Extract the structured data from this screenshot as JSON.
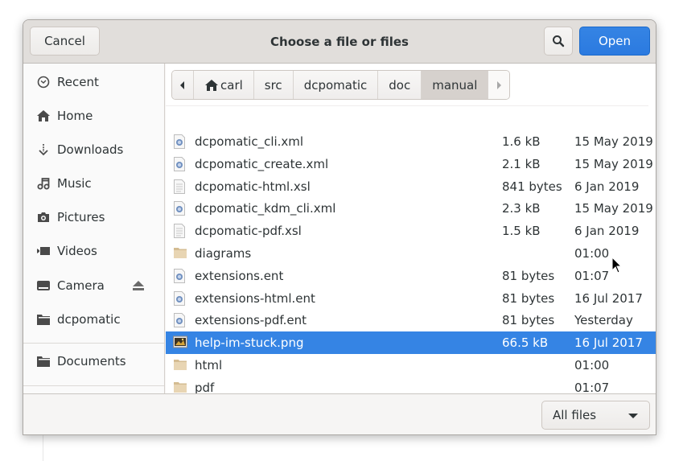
{
  "dialog": {
    "title": "Choose a file or files",
    "cancel_label": "Cancel",
    "open_label": "Open",
    "search_icon": "search-icon",
    "accent_color": "#3584e4"
  },
  "sidebar": {
    "items": [
      {
        "label": "Recent",
        "icon": "clock-icon"
      },
      {
        "label": "Home",
        "icon": "home-icon"
      },
      {
        "label": "Downloads",
        "icon": "download-icon"
      },
      {
        "label": "Music",
        "icon": "music-icon"
      },
      {
        "label": "Pictures",
        "icon": "camera-icon"
      },
      {
        "label": "Videos",
        "icon": "video-icon"
      },
      {
        "label": "Camera",
        "icon": "drive-icon",
        "eject": true
      },
      {
        "label": "dcpomatic",
        "icon": "folder-icon"
      },
      {
        "label": "Documents",
        "icon": "folder-icon"
      }
    ]
  },
  "pathbar": {
    "segments": [
      "carl",
      "src",
      "dcpomatic",
      "doc",
      "manual"
    ],
    "active": "manual"
  },
  "files": [
    {
      "name": "dcpomatic_cli.xml",
      "size": "1.6 kB",
      "modified": "15 May 2019",
      "type": "xml"
    },
    {
      "name": "dcpomatic_create.xml",
      "size": "2.1 kB",
      "modified": "15 May 2019",
      "type": "xml"
    },
    {
      "name": "dcpomatic-html.xsl",
      "size": "841 bytes",
      "modified": "6 Jan 2019",
      "type": "text"
    },
    {
      "name": "dcpomatic_kdm_cli.xml",
      "size": "2.3 kB",
      "modified": "15 May 2019",
      "type": "xml"
    },
    {
      "name": "dcpomatic-pdf.xsl",
      "size": "1.5 kB",
      "modified": "6 Jan 2019",
      "type": "text"
    },
    {
      "name": "diagrams",
      "size": "",
      "modified": "01:00",
      "type": "folder"
    },
    {
      "name": "extensions.ent",
      "size": "81 bytes",
      "modified": "01:07",
      "type": "xml"
    },
    {
      "name": "extensions-html.ent",
      "size": "81 bytes",
      "modified": "16 Jul 2017",
      "type": "xml"
    },
    {
      "name": "extensions-pdf.ent",
      "size": "81 bytes",
      "modified": "Yesterday",
      "type": "xml"
    },
    {
      "name": "help-im-stuck.png",
      "size": "66.5 kB",
      "modified": "16 Jul 2017",
      "type": "image",
      "selected": true
    },
    {
      "name": "html",
      "size": "",
      "modified": "01:00",
      "type": "folder"
    },
    {
      "name": "pdf",
      "size": "",
      "modified": "01:07",
      "type": "folder"
    }
  ],
  "footer": {
    "filter_label": "All files"
  }
}
